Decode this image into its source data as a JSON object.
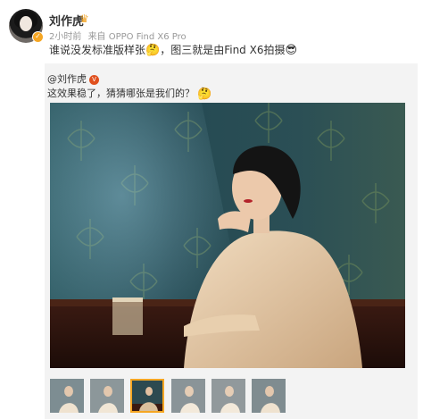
{
  "post": {
    "author": "刘作虎",
    "author_badge_icon": "crown-icon",
    "verified_icon": "verified-badge-icon",
    "time": "2小时前",
    "source_prefix": "来自",
    "source_device": "OPPO Find X6 Pro",
    "text_part1": "谁说没发标准版样张",
    "emoji1": "🤔",
    "text_part2": "，图三就是由Find X6拍摄",
    "emoji2": "😎"
  },
  "repost": {
    "mention": "@刘作虎",
    "badge_icon": "gold-v-icon",
    "text": "这效果稳了，猜猜哪张是我们的？",
    "emoji": "🤔",
    "image_alt": "photo-of-woman-at-bar-counter",
    "thumbnail_count": 6,
    "active_thumbnail_index": 3
  },
  "colors": {
    "accent": "#f5a623",
    "panel_bg": "#f3f3f3",
    "meta_text": "#999999"
  }
}
